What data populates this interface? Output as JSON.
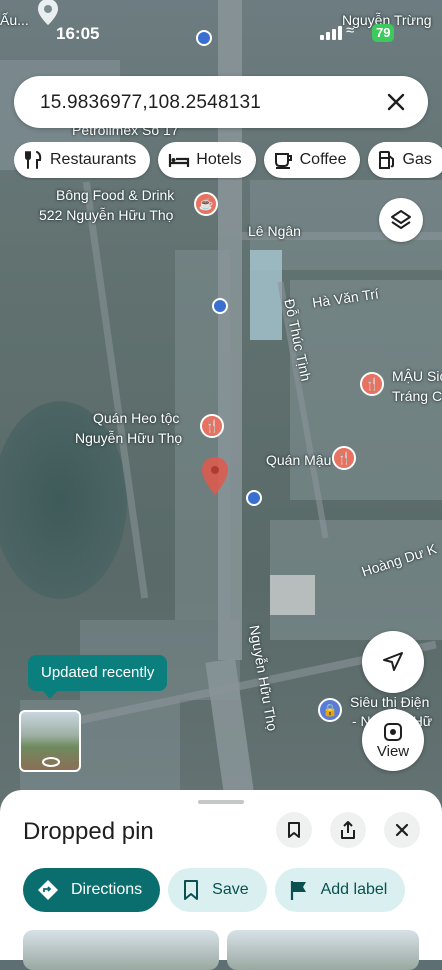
{
  "status_bar": {
    "time": "16:05",
    "battery": "79"
  },
  "search": {
    "query": "15.9836977,108.2548131"
  },
  "chips": [
    {
      "label": "Restaurants",
      "icon": "fork-knife-icon"
    },
    {
      "label": "Hotels",
      "icon": "bed-icon"
    },
    {
      "label": "Coffee",
      "icon": "coffee-cup-icon"
    },
    {
      "label": "Gas",
      "icon": "gas-pump-icon"
    }
  ],
  "map": {
    "labels": {
      "petrolimex": "Petrolimex Số 17",
      "bong_food_1": "Bông Food & Drink",
      "bong_food_2": "522 Nguyễn Hữu Thọ",
      "le_ngan": "Lê Ngân",
      "ha_van_tri": "Hà Văn Trí",
      "do_thuc_tinh": "Đỗ Thúc Tịnh",
      "mau_sic_1": "MẬU Sic",
      "mau_sic_2": "Tráng C",
      "quan_heo_1": "Quán Heo tộc",
      "quan_heo_2": "Nguyễn Hữu Thọ",
      "quan_mau": "Quán Mậu",
      "hoang_du_k": "Hoàng Dư K",
      "nguyen_huu_tho": "Nguyễn Hữu Thọ",
      "sieu_thi_1": "Siêu thị Điện",
      "sieu_thi_2": "- Nguyễn Hữ",
      "nguyen_trung": "Nguyễn Trừng",
      "top_left": "Ấu..."
    },
    "tooltip": "Updated recently",
    "view_label": "View"
  },
  "sheet": {
    "title": "Dropped pin",
    "actions": [
      {
        "label": "Directions",
        "icon": "directions-icon"
      },
      {
        "label": "Save",
        "icon": "bookmark-icon"
      },
      {
        "label": "Add label",
        "icon": "flag-icon"
      }
    ]
  },
  "colors": {
    "primary": "#0b6e6e",
    "secondary": "#d9eff0",
    "pin": "#e8715f",
    "tooltip": "#0b7e7e"
  }
}
